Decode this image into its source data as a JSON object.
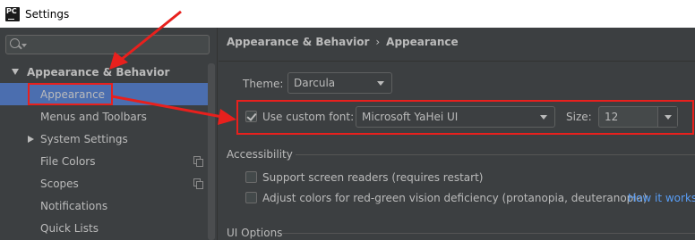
{
  "window": {
    "title": "Settings",
    "app_icon_text": "PC"
  },
  "sidebar": {
    "search_placeholder": "",
    "items": [
      {
        "label": "Appearance & Behavior"
      },
      {
        "label": "Appearance"
      },
      {
        "label": "Menus and Toolbars"
      },
      {
        "label": "System Settings"
      },
      {
        "label": "File Colors"
      },
      {
        "label": "Scopes"
      },
      {
        "label": "Notifications"
      },
      {
        "label": "Quick Lists"
      }
    ]
  },
  "breadcrumb": {
    "parent": "Appearance & Behavior",
    "separator": "›",
    "current": "Appearance"
  },
  "theme": {
    "label": "Theme:",
    "value": "Darcula"
  },
  "font": {
    "checkbox_label": "Use custom font:",
    "checked": true,
    "value": "Microsoft YaHei UI",
    "size_label": "Size:",
    "size_value": "12"
  },
  "accessibility": {
    "title": "Accessibility",
    "screen_readers_label": "Support screen readers (requires restart)",
    "color_blind_label": "Adjust colors for red-green vision deficiency (protanopia, deuteranopia)",
    "how_it_works_link": "How it works"
  },
  "ui_options": {
    "title": "UI Options"
  },
  "colors": {
    "annotation_red": "#e8201d",
    "selection_blue": "#4b6eaf",
    "link_blue": "#589df6",
    "panel_bg": "#3c3f41"
  }
}
